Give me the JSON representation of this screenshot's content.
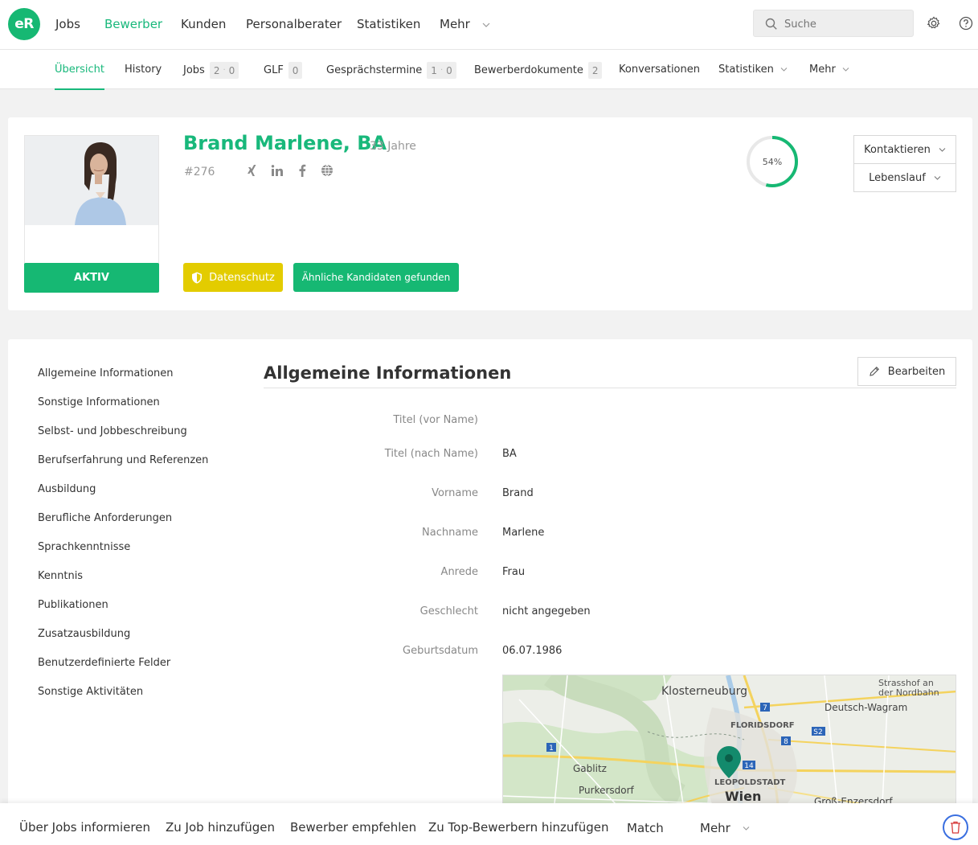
{
  "topnav": {
    "logo": "eR",
    "items": [
      "Jobs",
      "Bewerber",
      "Kunden",
      "Personalberater",
      "Statistiken",
      "Mehr"
    ],
    "active": "Bewerber",
    "search_placeholder": "Suche"
  },
  "subnav": {
    "overview": "Übersicht",
    "history": "History",
    "jobs": "Jobs",
    "jobs_badge": [
      "2",
      "0"
    ],
    "glf": "GLF",
    "glf_badge": "0",
    "appointments": "Gesprächstermine",
    "appointments_badge": [
      "1",
      "0"
    ],
    "documents": "Bewerberdokumente",
    "documents_badge": "2",
    "conversations": "Konversationen",
    "statistics": "Statistiken",
    "more": "Mehr"
  },
  "profile": {
    "name": "Brand Marlene, BA",
    "age": "33 Jahre",
    "id": "#276",
    "status": "AKTIV",
    "privacy_button": "Datenschutz",
    "similar_button": "Ähnliche Kandidaten gefunden",
    "completion_label": "54%",
    "completion": 0.54,
    "contact_button": "Kontaktieren",
    "cv_button": "Lebenslauf",
    "accent": "#16b873"
  },
  "sidebar": {
    "items": [
      "Allgemeine Informationen",
      "Sonstige Informationen",
      "Selbst- und Jobbeschreibung",
      "Berufserfahrung und Referenzen",
      "Ausbildung",
      "Berufliche Anforderungen",
      "Sprachkenntnisse",
      "Kenntnis",
      "Publikationen",
      "Zusatzausbildung",
      "Benutzerdefinierte Felder",
      "Sonstige Aktivitäten"
    ]
  },
  "general": {
    "title": "Allgemeine Informationen",
    "edit_button": "Bearbeiten",
    "fields": [
      {
        "label": "Titel (vor Name)",
        "value": ""
      },
      {
        "label": "Titel (nach Name)",
        "value": "BA"
      },
      {
        "label": "Vorname",
        "value": "Brand"
      },
      {
        "label": "Nachname",
        "value": "Marlene"
      },
      {
        "label": "Anrede",
        "value": "Frau"
      },
      {
        "label": "Geschlecht",
        "value": "nicht angegeben"
      },
      {
        "label": "Geburtsdatum",
        "value": "06.07.1986"
      }
    ]
  },
  "map": {
    "labels": [
      "Klosterneuburg",
      "Strasshof an",
      "der Nordbahn",
      "Deutsch-Wagram",
      "FLORIDSDORF",
      "Gablitz",
      "LEOPOLDSTADT",
      "Purkersdorf",
      "Wien",
      "Groß-Enzersdorf"
    ],
    "shields": [
      "7",
      "8",
      "S2",
      "1",
      "14"
    ]
  },
  "bottombar": {
    "items": [
      "Über Jobs informieren",
      "Zu Job hinzufügen",
      "Bewerber empfehlen",
      "Zu Top-Bewerbern hinzufügen",
      "Match",
      "Mehr"
    ]
  }
}
